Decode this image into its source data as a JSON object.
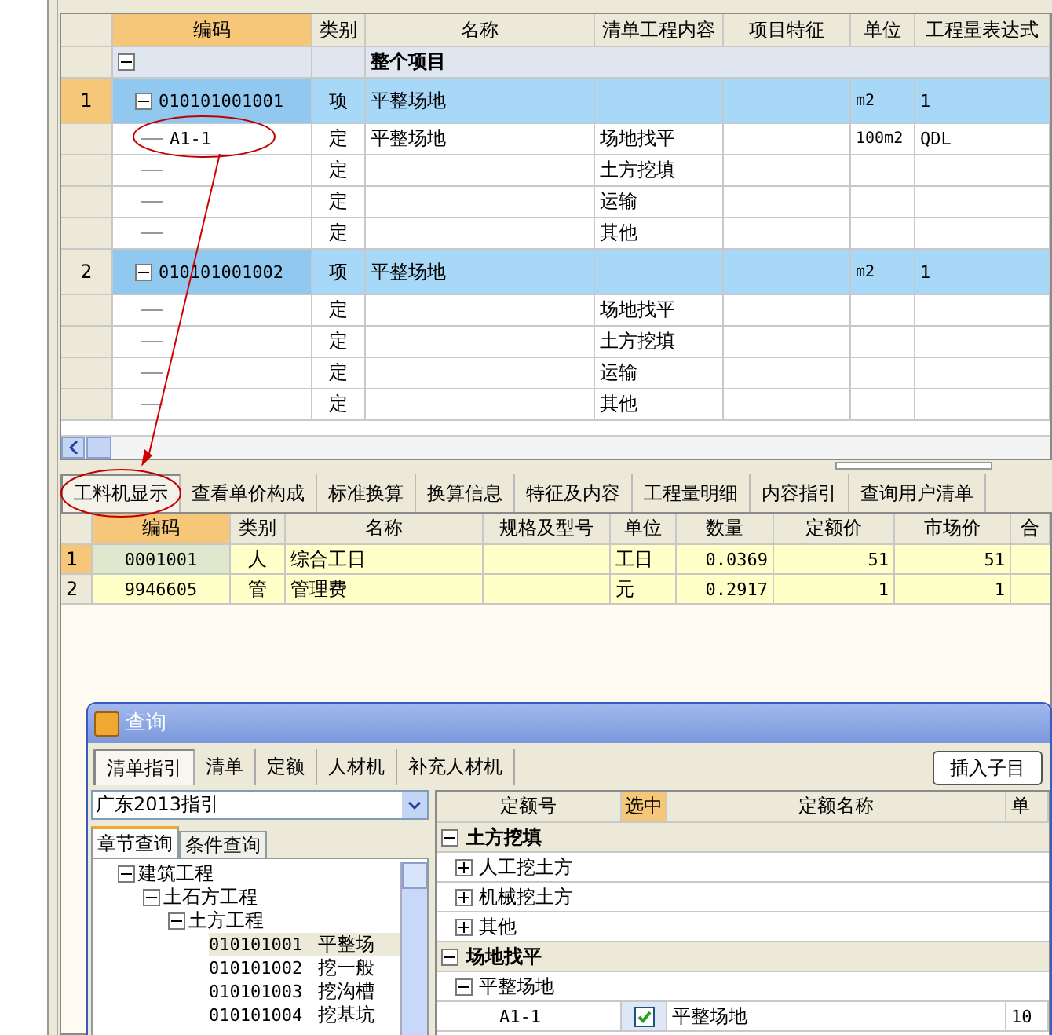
{
  "main_grid": {
    "columns": [
      "编码",
      "类别",
      "名称",
      "清单工程内容",
      "项目特征",
      "单位",
      "工程量表达式"
    ],
    "root": {
      "label": "整个项目",
      "expanded": true
    },
    "rows": [
      {
        "kind": "item",
        "num": "1",
        "code": "010101001001",
        "type": "项",
        "name": "平整场地",
        "unit": "m2",
        "expr": "1",
        "expanded": true
      },
      {
        "kind": "sub",
        "code": "A1-1",
        "type": "定",
        "name": "平整场地",
        "content": "场地找平",
        "unit": "100m2",
        "expr": "QDL"
      },
      {
        "kind": "sub",
        "type": "定",
        "content": "土方挖填"
      },
      {
        "kind": "sub",
        "type": "定",
        "content": "运输"
      },
      {
        "kind": "sub",
        "type": "定",
        "content": "其他"
      },
      {
        "kind": "item",
        "num": "2",
        "code": "010101001002",
        "type": "项",
        "name": "平整场地",
        "unit": "m2",
        "expr": "1",
        "expanded": true
      },
      {
        "kind": "sub",
        "type": "定",
        "content": "场地找平"
      },
      {
        "kind": "sub",
        "type": "定",
        "content": "土方挖填"
      },
      {
        "kind": "sub",
        "type": "定",
        "content": "运输"
      },
      {
        "kind": "sub",
        "type": "定",
        "content": "其他"
      }
    ]
  },
  "bottom_tabs": [
    {
      "label": "工料机显示",
      "selected": true
    },
    {
      "label": "查看单价构成",
      "selected": false
    },
    {
      "label": "标准换算",
      "selected": false
    },
    {
      "label": "换算信息",
      "selected": false
    },
    {
      "label": "特征及内容",
      "selected": false
    },
    {
      "label": "工程量明细",
      "selected": false
    },
    {
      "label": "内容指引",
      "selected": false
    },
    {
      "label": "查询用户清单",
      "selected": false
    }
  ],
  "resource_grid": {
    "columns": [
      "编码",
      "类别",
      "名称",
      "规格及型号",
      "单位",
      "数量",
      "定额价",
      "市场价",
      "合"
    ],
    "rows": [
      {
        "num": "1",
        "code": "0001001",
        "type": "人",
        "name": "综合工日",
        "unit": "工日",
        "qty": "0.0369",
        "quota_price": "51",
        "market_price": "51"
      },
      {
        "num": "2",
        "code": "9946605",
        "type": "管",
        "name": "管理费",
        "unit": "元",
        "qty": "0.2917",
        "quota_price": "1",
        "market_price": "1"
      }
    ]
  },
  "dialog": {
    "title": "查询",
    "tabs": [
      {
        "label": "清单指引",
        "selected": true
      },
      {
        "label": "清单",
        "selected": false
      },
      {
        "label": "定额",
        "selected": false
      },
      {
        "label": "人材机",
        "selected": false
      },
      {
        "label": "补充人材机",
        "selected": false
      }
    ],
    "insert_button": "插入子目",
    "library_select": "广东2013指引",
    "search_tabs": [
      {
        "label": "章节查询",
        "selected": true
      },
      {
        "label": "条件查询",
        "selected": false
      }
    ],
    "tree": [
      {
        "label": "建筑工程",
        "expanded": true,
        "children": [
          {
            "label": "土石方工程",
            "expanded": true,
            "children": [
              {
                "label": "土方工程",
                "expanded": true,
                "children": [
                  {
                    "code": "010101001",
                    "name": "平整场",
                    "selected": true
                  },
                  {
                    "code": "010101002",
                    "name": "挖一般",
                    "selected": false
                  },
                  {
                    "code": "010101003",
                    "name": "挖沟槽",
                    "selected": false
                  },
                  {
                    "code": "010101004",
                    "name": "挖基坑",
                    "selected": false
                  }
                ]
              }
            ]
          }
        ]
      }
    ],
    "quota_grid": {
      "columns": [
        "定额号",
        "选中",
        "定额名称",
        "单"
      ],
      "groups": [
        {
          "label": "土方挖填",
          "expanded": true,
          "children": [
            {
              "label": "人工挖土方",
              "expanded": false
            },
            {
              "label": "机械挖土方",
              "expanded": false
            },
            {
              "label": "其他",
              "expanded": false
            }
          ]
        },
        {
          "label": "场地找平",
          "expanded": true,
          "children": [
            {
              "label": "平整场地",
              "expanded": true,
              "items": [
                {
                  "code": "A1-1",
                  "checked": true,
                  "name": "平整场地",
                  "unit": "10"
                }
              ]
            }
          ]
        }
      ]
    }
  }
}
